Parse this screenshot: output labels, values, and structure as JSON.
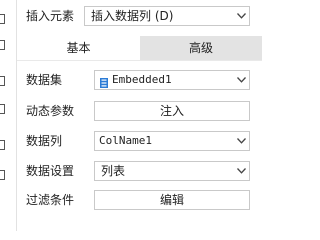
{
  "insert": {
    "label": "插入元素",
    "value": "插入数据列 (D)"
  },
  "tabs": [
    {
      "label": "基本",
      "active": true
    },
    {
      "label": "高级",
      "active": false
    }
  ],
  "form": {
    "dataset": {
      "label": "数据集",
      "value": "Embedded1",
      "icon": "database-icon"
    },
    "dynamic_params": {
      "label": "动态参数",
      "button": "注入"
    },
    "data_column": {
      "label": "数据列",
      "value": "ColName1"
    },
    "data_settings": {
      "label": "数据设置",
      "value": "列表"
    },
    "filter": {
      "label": "过滤条件",
      "button": "编辑"
    }
  },
  "colors": {
    "active_tab": "#ffffff",
    "inactive_tab": "#e3e3e3",
    "border": "#c9c9c9",
    "db_icon": "#2b7bd6"
  }
}
